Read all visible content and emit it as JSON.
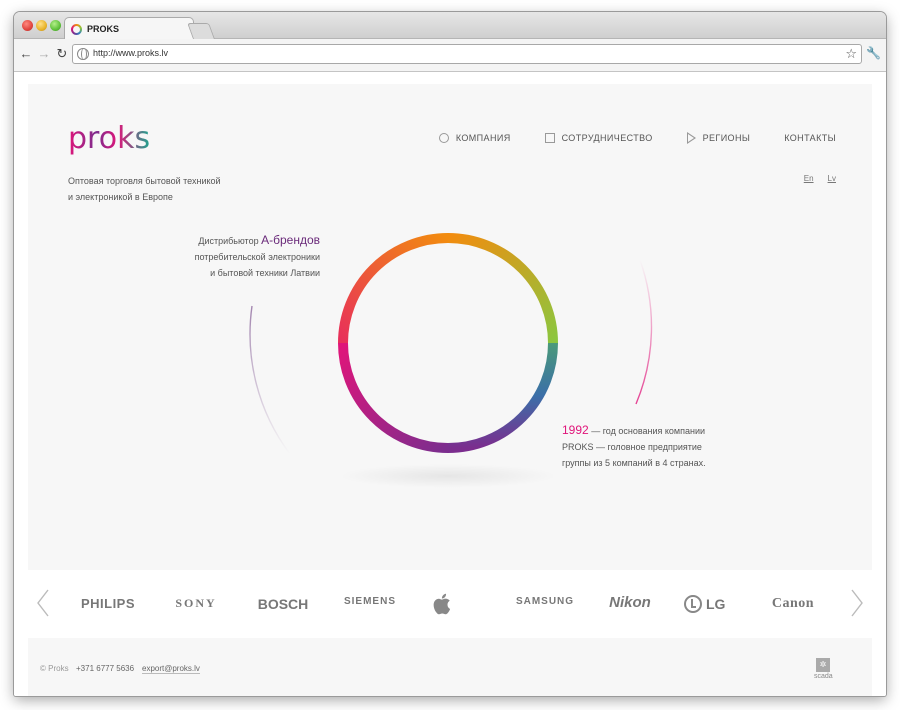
{
  "browser": {
    "tab_title": "PROKS",
    "url": "http://www.proks.lv"
  },
  "header": {
    "logo_text": "proks",
    "tagline_line1": "Оптовая торговля бытовой техникой",
    "tagline_line2": "и электроникой в Европе",
    "nav": [
      {
        "label": "КОМПАНИЯ",
        "icon": "circle-icon"
      },
      {
        "label": "СОТРУДНИЧЕСТВО",
        "icon": "square-icon"
      },
      {
        "label": "РЕГИОНЫ",
        "icon": "triangle-icon"
      },
      {
        "label": "КОНТАКТЫ",
        "icon": ""
      }
    ],
    "languages": [
      "En",
      "Lv"
    ]
  },
  "hero": {
    "distributor_prefix": "Дистрибьютор ",
    "distributor_highlight": "А-брендов",
    "distributor_line2": "потребительской электроники",
    "distributor_line3": "и бытовой техники Латвии",
    "year": "1992",
    "founded_rest": " — год основания компании",
    "founded_line2": "PROKS — головное предприятие",
    "founded_line3": "группы из 5 компаний в 4 странах."
  },
  "brands": [
    "PHILIPS",
    "SONY",
    "BOSCH",
    "SIEMENS",
    "apple",
    "SAMSUNG",
    "Nikon",
    "LG",
    "Canon"
  ],
  "footer": {
    "copyright": "© Proks",
    "phone": "+371 6777 5636",
    "email": "export@proks.lv",
    "studio": "scada"
  },
  "colors": {
    "ring_orange": "#f28c0f",
    "ring_green": "#8cc63f",
    "ring_blue": "#2e7fc1",
    "ring_purple": "#7b2d8e",
    "ring_magenta": "#e0157a",
    "accent_purple": "#6a2a7a"
  }
}
